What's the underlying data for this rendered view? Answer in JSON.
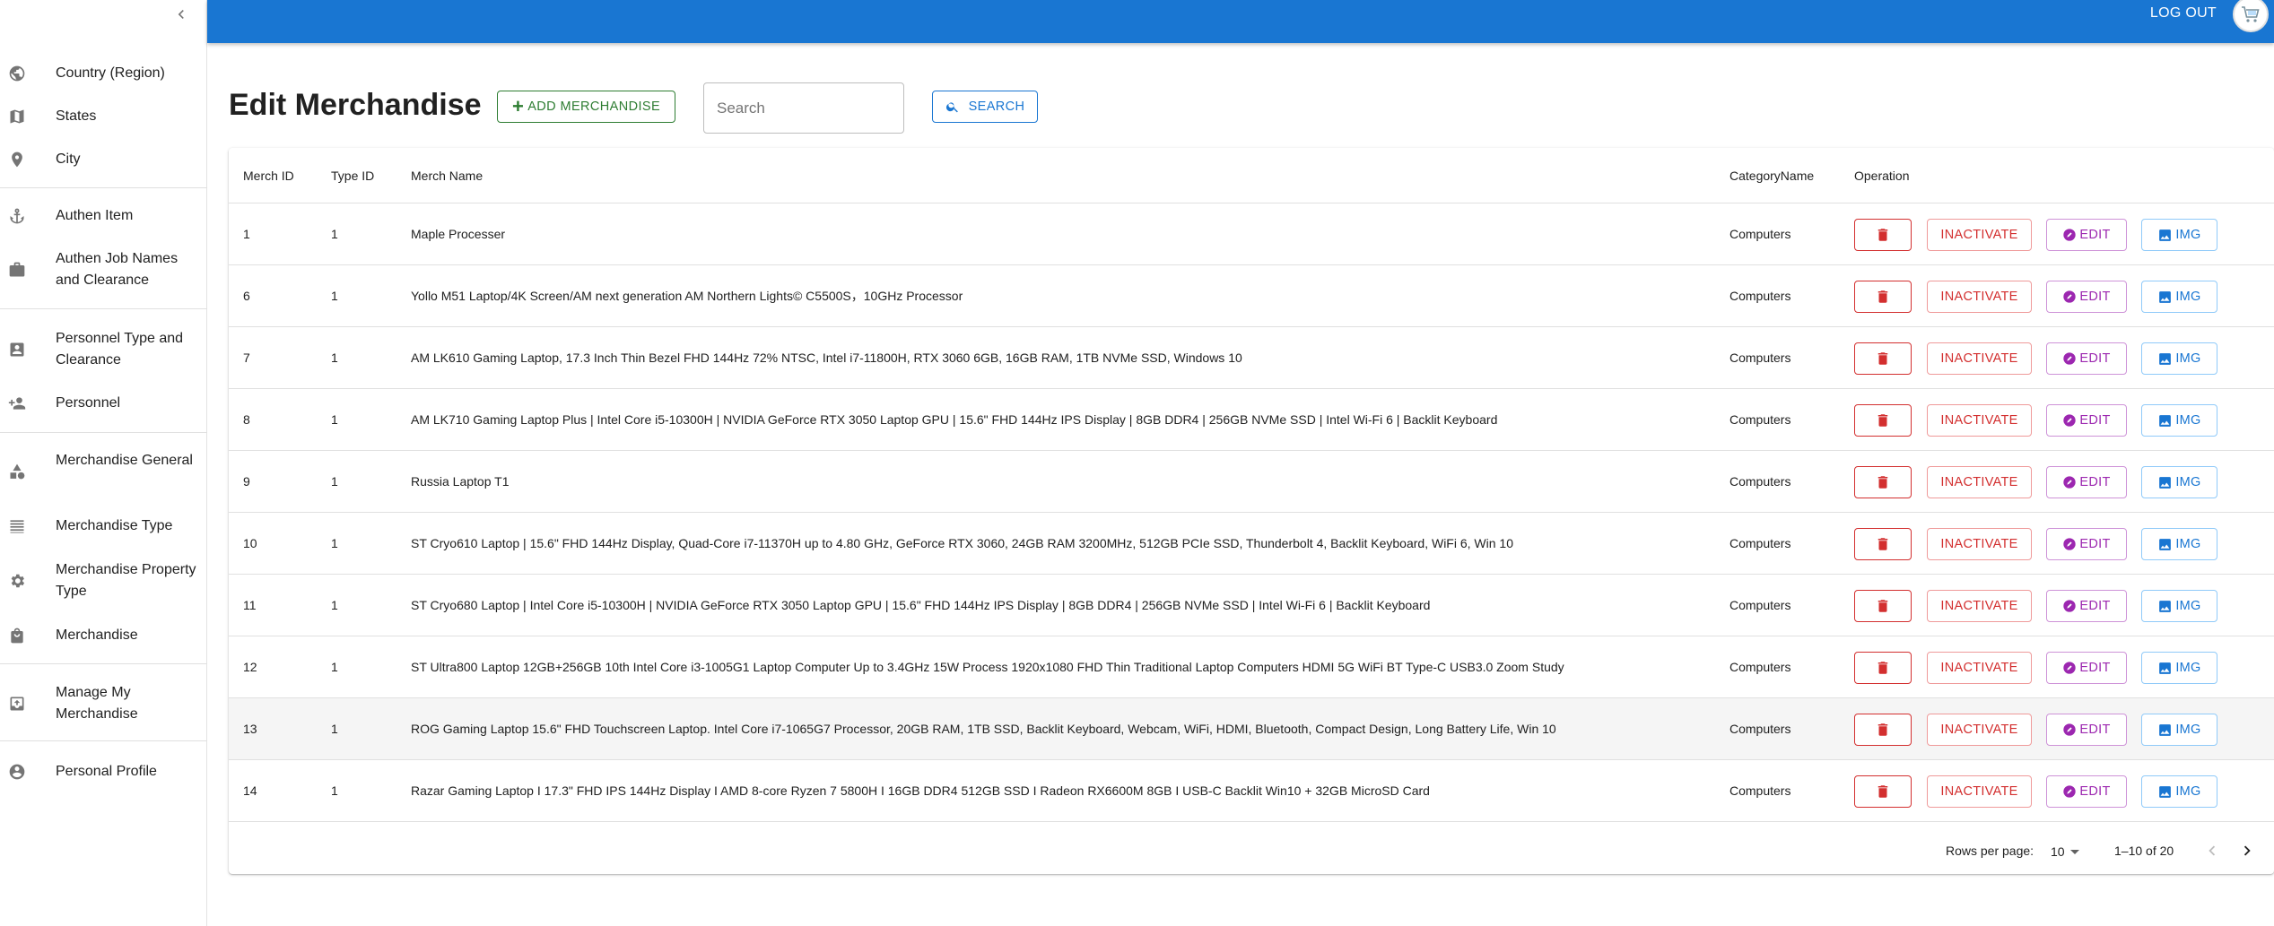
{
  "topbar": {
    "logout_label": "LOG OUT"
  },
  "sidebar": {
    "items": [
      {
        "label": "Country (Region)",
        "icon": "globe-icon"
      },
      {
        "label": "States",
        "icon": "map-icon"
      },
      {
        "label": "City",
        "icon": "location-pin-icon"
      },
      {
        "label": "Authen Item",
        "icon": "anchor-icon"
      },
      {
        "label": "Authen Job Names and Clearance",
        "icon": "briefcase-icon"
      },
      {
        "label": "Personnel Type and Clearance",
        "icon": "contact-card-icon"
      },
      {
        "label": "Personnel",
        "icon": "person-add-icon"
      },
      {
        "label": "Merchandise General",
        "icon": "category-shapes-icon"
      },
      {
        "label": "Merchandise Type",
        "icon": "list-lines-icon"
      },
      {
        "label": "Merchandise Property Type",
        "icon": "gear-icon"
      },
      {
        "label": "Merchandise",
        "icon": "shopping-bag-icon"
      },
      {
        "label": "Manage My Merchandise",
        "icon": "inventory-icon"
      },
      {
        "label": "Personal Profile",
        "icon": "account-circle-icon"
      }
    ]
  },
  "main": {
    "title": "Edit Merchandise",
    "add_button_label": "ADD MERCHANDISE",
    "search_placeholder": "Search",
    "search_button_label": "SEARCH"
  },
  "table": {
    "columns": [
      "Merch ID",
      "Type ID",
      "Merch Name",
      "CategoryName",
      "Operation"
    ],
    "actions": {
      "inactivate": "INACTIVATE",
      "edit": "EDIT",
      "img": "IMG"
    },
    "rows": [
      {
        "id": "1",
        "type": "1",
        "name": "Maple Processer",
        "category": "Computers"
      },
      {
        "id": "6",
        "type": "1",
        "name": "Yollo M51 Laptop/4K Screen/AM next generation AM Northern Lights© C5500S，10GHz Processor",
        "category": "Computers"
      },
      {
        "id": "7",
        "type": "1",
        "name": "AM LK610 Gaming Laptop, 17.3 Inch Thin Bezel FHD 144Hz 72% NTSC, Intel i7-11800H, RTX 3060 6GB, 16GB RAM, 1TB NVMe SSD, Windows 10",
        "category": "Computers"
      },
      {
        "id": "8",
        "type": "1",
        "name": "AM LK710 Gaming Laptop Plus | Intel Core i5-10300H | NVIDIA GeForce RTX 3050 Laptop GPU | 15.6\" FHD 144Hz IPS Display | 8GB DDR4 | 256GB NVMe SSD | Intel Wi-Fi 6 | Backlit Keyboard",
        "category": "Computers"
      },
      {
        "id": "9",
        "type": "1",
        "name": "Russia Laptop T1",
        "category": "Computers"
      },
      {
        "id": "10",
        "type": "1",
        "name": "ST Cryo610 Laptop | 15.6\" FHD 144Hz Display, Quad-Core i7-11370H up to 4.80 GHz, GeForce RTX 3060, 24GB RAM 3200MHz, 512GB PCIe SSD, Thunderbolt 4, Backlit Keyboard, WiFi 6, Win 10",
        "category": "Computers"
      },
      {
        "id": "11",
        "type": "1",
        "name": "ST Cryo680 Laptop | Intel Core i5-10300H | NVIDIA GeForce RTX 3050 Laptop GPU | 15.6\" FHD 144Hz IPS Display | 8GB DDR4 | 256GB NVMe SSD | Intel Wi-Fi 6 | Backlit Keyboard",
        "category": "Computers"
      },
      {
        "id": "12",
        "type": "1",
        "name": "ST Ultra800 Laptop 12GB+256GB 10th Intel Core i3-1005G1 Laptop Computer Up to 3.4GHz 15W Process 1920x1080 FHD Thin Traditional Laptop Computers HDMI 5G WiFi BT Type-C USB3.0 Zoom Study",
        "category": "Computers"
      },
      {
        "id": "13",
        "type": "1",
        "name": "ROG Gaming Laptop 15.6\" FHD Touchscreen Laptop. Intel Core i7-1065G7 Processor, 20GB RAM, 1TB SSD, Backlit Keyboard, Webcam, WiFi, HDMI, Bluetooth, Compact Design, Long Battery Life, Win 10",
        "category": "Computers"
      },
      {
        "id": "14",
        "type": "1",
        "name": "Razar Gaming Laptop I 17.3\" FHD IPS 144Hz Display I AMD 8-core Ryzen 7 5800H I 16GB DDR4 512GB SSD I Radeon RX6600M 8GB I USB-C Backlit Win10 + 32GB MicroSD Card",
        "category": "Computers"
      }
    ],
    "footer": {
      "rows_per_page_label": "Rows per page:",
      "rows_per_page_value": "10",
      "page_range": "1–10 of 20"
    }
  },
  "colors": {
    "appbar": "#1976d2",
    "add_green": "#2e7d32",
    "danger_red": "#d32f2f",
    "edit_purple": "#9c27b0",
    "img_blue": "#1976d2"
  }
}
